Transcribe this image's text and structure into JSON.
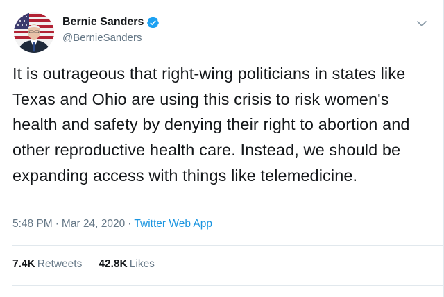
{
  "author": {
    "display_name": "Bernie Sanders",
    "handle": "@BernieSanders",
    "verified": true
  },
  "tweet": {
    "text": "It is outrageous that right-wing politicians in states like Texas and Ohio are using this crisis to risk women's health and safety by denying their right to abortion and other reproductive health care. Instead, we should be expanding access with things like telemedicine.",
    "time": "5:48 PM",
    "date": "Mar 24, 2020",
    "separator": "·",
    "client": "Twitter Web App"
  },
  "stats": {
    "retweets_count": "7.4K",
    "retweets_label": "Retweets",
    "likes_count": "42.8K",
    "likes_label": "Likes"
  },
  "icons": {
    "verified": "verified-badge-icon",
    "caret": "chevron-down-icon"
  },
  "colors": {
    "link": "#1b95e0",
    "verified": "#1da1f2",
    "secondary_text": "#657786",
    "divider": "#e1e8ed"
  }
}
